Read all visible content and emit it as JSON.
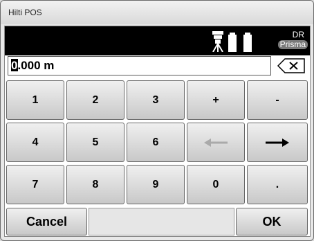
{
  "window": {
    "title": "Hilti POS"
  },
  "status": {
    "dr_label": "DR",
    "prism_label": "Prisma",
    "instrument_icon": "tripod-instrument-icon",
    "battery_icon": "battery-icon"
  },
  "entry": {
    "value": "0.000 m",
    "cursor_char": "0",
    "rest": ".000 m",
    "clear_icon": "backspace-icon"
  },
  "keypad": {
    "rows": [
      [
        {
          "label": "1"
        },
        {
          "label": "2"
        },
        {
          "label": "3"
        },
        {
          "label": "+"
        },
        {
          "label": "-"
        }
      ],
      [
        {
          "label": "4"
        },
        {
          "label": "5"
        },
        {
          "label": "6"
        },
        {
          "label": "←",
          "icon": "arrow-left-icon",
          "disabled": true
        },
        {
          "label": "→",
          "icon": "arrow-right-icon"
        }
      ],
      [
        {
          "label": "7"
        },
        {
          "label": "8"
        },
        {
          "label": "9"
        },
        {
          "label": "0"
        },
        {
          "label": "."
        }
      ]
    ]
  },
  "footer": {
    "cancel_label": "Cancel",
    "ok_label": "OK"
  },
  "colors": {
    "status_bar": "#000000",
    "prism_badge": "#7a7a7a",
    "key_face": "#dcdcdc"
  }
}
